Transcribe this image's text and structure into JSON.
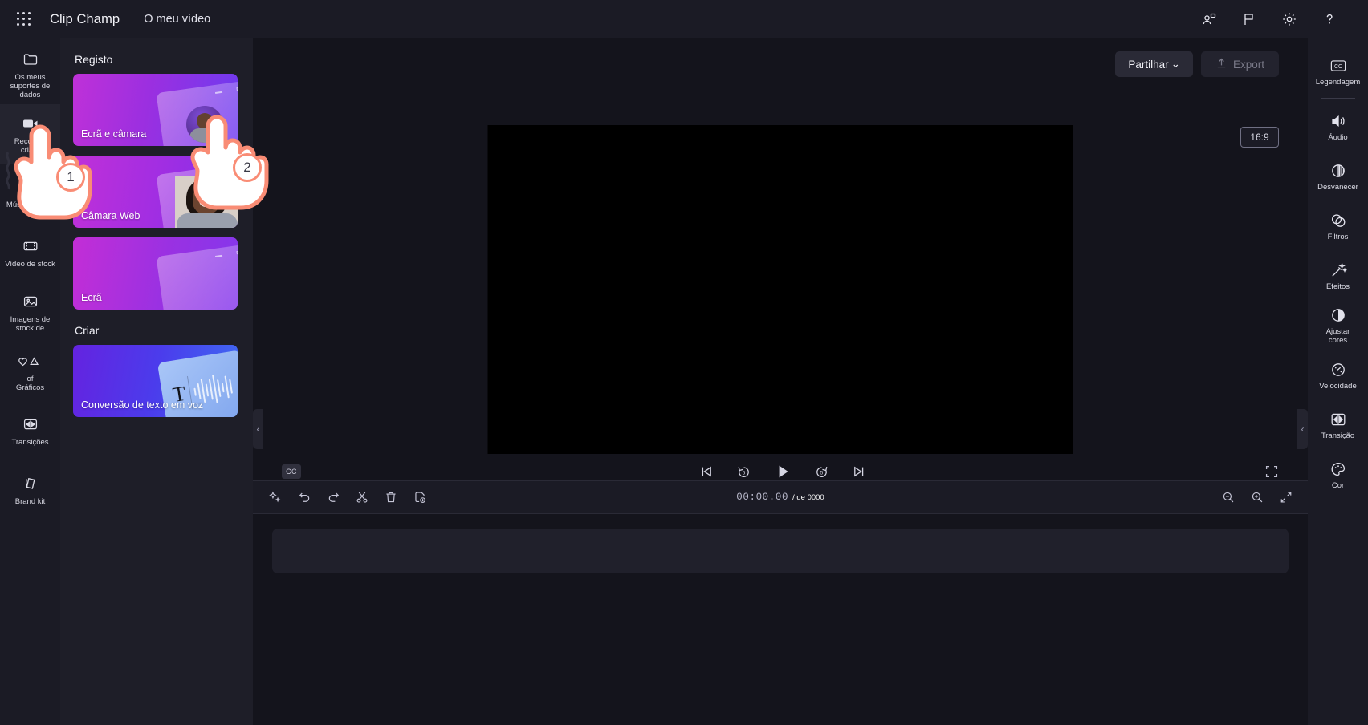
{
  "app": {
    "brand": "Clip Champ",
    "project_name": "O meu vídeo",
    "waffle_icon": "app-launcher-icon"
  },
  "topbar": {
    "icons": [
      {
        "name": "share-people-icon",
        "label": "Partilhar com pessoas"
      },
      {
        "name": "flag-icon",
        "label": "Comentários"
      },
      {
        "name": "gear-icon",
        "label": "Definições"
      },
      {
        "name": "help-icon",
        "label": "Ajuda"
      }
    ]
  },
  "left_rail": {
    "items": [
      {
        "label": "Os meus suportes de dados",
        "icon": "folder-icon",
        "active": false
      },
      {
        "label": "Record &\ncriate",
        "icon": "camera-record-icon",
        "active": true
      },
      {
        "label": "Música e SFX",
        "icon": "music-note-icon",
        "active": false
      },
      {
        "label": "Vídeo de stock",
        "icon": "film-strip-icon",
        "active": false
      },
      {
        "label": "Imagens de stock de",
        "icon": "image-icon",
        "active": false
      },
      {
        "label": "of\nGráficos",
        "icon": "shapes-icon",
        "active": false
      },
      {
        "label": "Transições",
        "icon": "transition-icon",
        "active": false
      },
      {
        "label": "Brand kit",
        "icon": "brand-kit-icon",
        "active": false
      }
    ]
  },
  "panel": {
    "section_record": "Registo",
    "section_create": "Criar",
    "cards": [
      {
        "label": "Ecrã e câmara",
        "art": "screen-and-camera"
      },
      {
        "label": "Câmara Web",
        "art": "webcam"
      },
      {
        "label": "Ecrã",
        "art": "screen"
      },
      {
        "label": "Conversão de texto em voz",
        "art": "text-to-speech"
      }
    ]
  },
  "stage": {
    "share_label": "Partilhar",
    "share_caret": "⌄",
    "export_label": "Export",
    "export_icon": "upload-icon",
    "aspect_ratio": "16:9",
    "cc_label": "CC",
    "transport": [
      {
        "name": "skip-to-start-button",
        "glyph": "skip-start"
      },
      {
        "name": "rewind-5-button",
        "glyph": "back-5"
      },
      {
        "name": "play-button",
        "glyph": "play"
      },
      {
        "name": "forward-5-button",
        "glyph": "forward-5"
      },
      {
        "name": "skip-to-end-button",
        "glyph": "skip-end"
      }
    ],
    "fullscreen_icon": "fullscreen-icon"
  },
  "timeline": {
    "tools": [
      {
        "name": "magic-sparkle-button",
        "icon": "sparkle-icon"
      },
      {
        "name": "undo-button",
        "icon": "undo-icon"
      },
      {
        "name": "redo-button",
        "icon": "redo-icon"
      },
      {
        "name": "split-button",
        "icon": "scissors-icon"
      },
      {
        "name": "delete-button",
        "icon": "trash-icon"
      },
      {
        "name": "duplicate-button",
        "icon": "duplicate-icon"
      }
    ],
    "current_time": "00:00.00",
    "total_time": "/ de 0000",
    "zoom_tools": [
      {
        "name": "zoom-out-button",
        "icon": "zoom-out-icon"
      },
      {
        "name": "zoom-in-button",
        "icon": "zoom-in-icon"
      },
      {
        "name": "fit-to-screen-button",
        "icon": "fit-screen-icon"
      }
    ]
  },
  "right_rail": {
    "items": [
      {
        "label": "Legendagem",
        "icon": "closed-captions-icon"
      },
      {
        "label": "Áudio",
        "icon": "speaker-icon"
      },
      {
        "label": "Desvanecer",
        "icon": "fade-icon"
      },
      {
        "label": "Filtros",
        "icon": "filters-icon"
      },
      {
        "label": "Efeitos",
        "icon": "magic-wand-icon"
      },
      {
        "label": "Ajustar\ncores",
        "icon": "contrast-icon"
      },
      {
        "label": "Velocidade",
        "icon": "speedometer-icon"
      },
      {
        "label": "Transição",
        "icon": "transition-icon"
      },
      {
        "label": "Cor",
        "icon": "palette-icon"
      }
    ]
  },
  "annotations": {
    "steps": [
      {
        "number": "1",
        "target": "left-rail-record-and-create"
      },
      {
        "number": "2",
        "target": "card-screen-and-camera"
      }
    ]
  },
  "collapse": {
    "left_chevron": "‹",
    "right_chevron": "‹"
  },
  "colors": {
    "app_bg": "#14141c",
    "chrome": "#1b1b25",
    "panel": "#1e1e28",
    "accent_purple": "#9b2fe0",
    "annotation": "#f98c75"
  }
}
